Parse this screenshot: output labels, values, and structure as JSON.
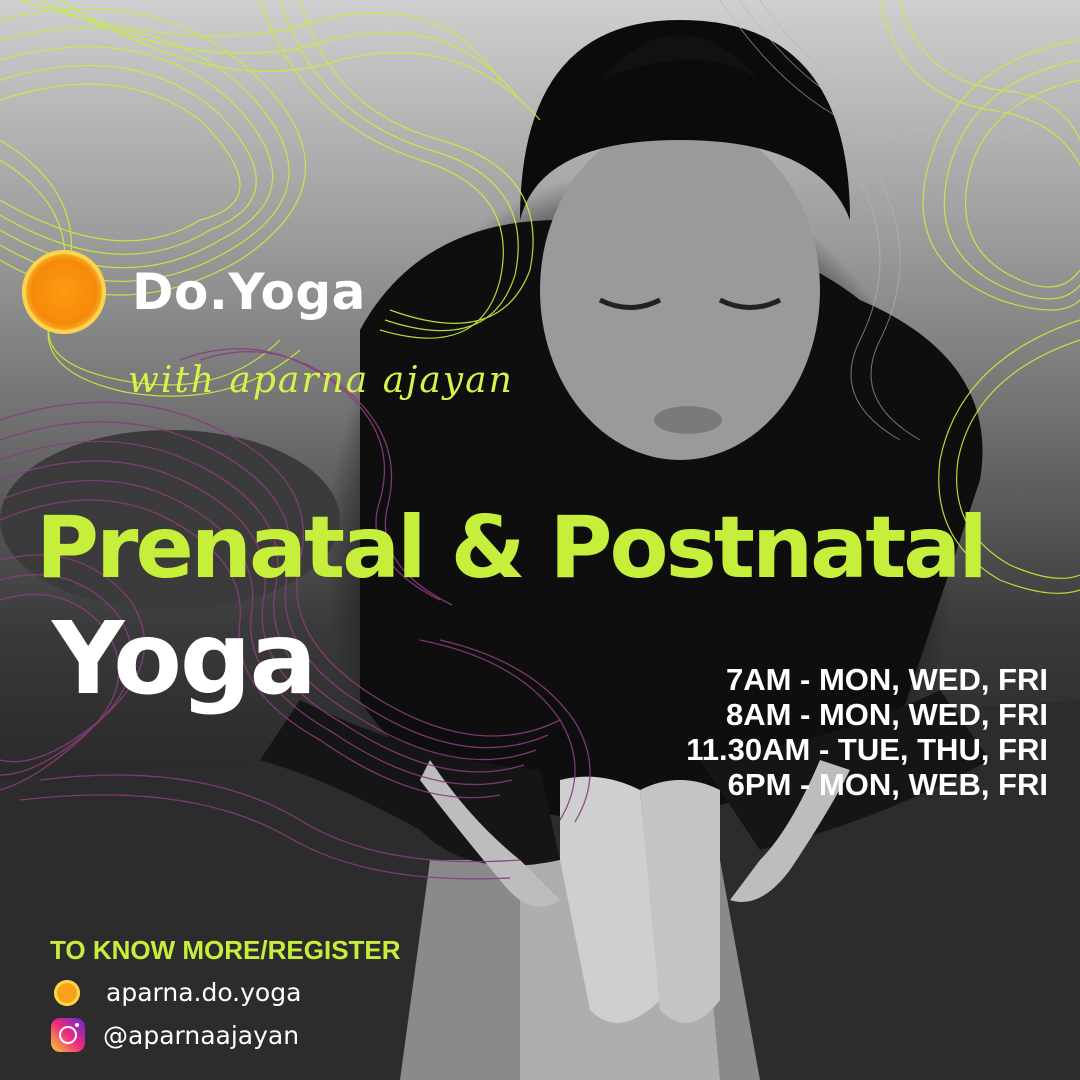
{
  "brand": {
    "name": "Do.Yoga",
    "tagline": "with aparna ajayan"
  },
  "headline": "Prenatal & Postnatal",
  "subheadline": "Yoga",
  "schedule": [
    "7AM - MON, WED, FRI",
    "8AM - MON, WED, FRI",
    "11.30AM - TUE, THU, FRI",
    "6PM - MON, WEB, FRI"
  ],
  "cta": "TO KNOW MORE/REGISTER",
  "contacts": {
    "website": {
      "icon": "sun-dot-icon",
      "text": "aparna.do.yoga"
    },
    "instagram": {
      "icon": "instagram-icon",
      "text": "@aparnaajayan"
    }
  },
  "colors": {
    "accent_green": "#c6ef3c",
    "sun_orange": "#f58a0a",
    "purple_lines": "#7a3a6e",
    "text_white": "#ffffff"
  }
}
